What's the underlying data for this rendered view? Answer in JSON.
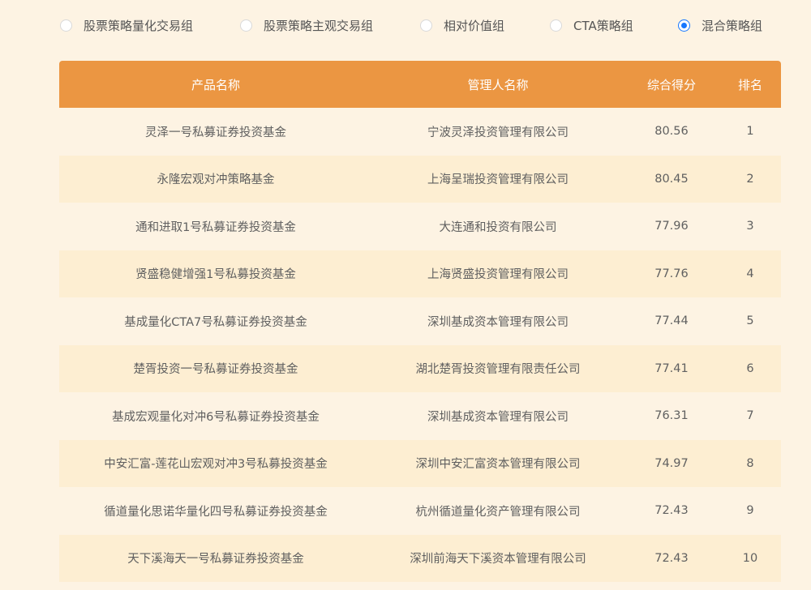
{
  "tabs": [
    {
      "label": "股票策略量化交易组",
      "checked": false
    },
    {
      "label": "股票策略主观交易组",
      "checked": false
    },
    {
      "label": "相对价值组",
      "checked": false
    },
    {
      "label": "CTA策略组",
      "checked": false
    },
    {
      "label": "混合策略组",
      "checked": true
    }
  ],
  "colors": {
    "header_bg": "#eb9642",
    "radio_accent": "#1677ff",
    "page_bg": "#fdf3e3",
    "row_alt_bg": "#fdeed2"
  },
  "table": {
    "headers": [
      "产品名称",
      "管理人名称",
      "综合得分",
      "排名"
    ],
    "rows": [
      [
        "灵泽一号私募证券投资基金",
        "宁波灵泽投资管理有限公司",
        "80.56",
        "1"
      ],
      [
        "永隆宏观对冲策略基金",
        "上海呈瑞投资管理有限公司",
        "80.45",
        "2"
      ],
      [
        "通和进取1号私募证券投资基金",
        "大连通和投资有限公司",
        "77.96",
        "3"
      ],
      [
        "贤盛稳健增强1号私募投资基金",
        "上海贤盛投资管理有限公司",
        "77.76",
        "4"
      ],
      [
        "基成量化CTA7号私募证券投资基金",
        "深圳基成资本管理有限公司",
        "77.44",
        "5"
      ],
      [
        "楚胥投资一号私募证券投资基金",
        "湖北楚胥投资管理有限责任公司",
        "77.41",
        "6"
      ],
      [
        "基成宏观量化对冲6号私募证券投资基金",
        "深圳基成资本管理有限公司",
        "76.31",
        "7"
      ],
      [
        "中安汇富-莲花山宏观对冲3号私募投资基金",
        "深圳中安汇富资本管理有限公司",
        "74.97",
        "8"
      ],
      [
        "循道量化思诺华量化四号私募证券投资基金",
        "杭州循道量化资产管理有限公司",
        "72.43",
        "9"
      ],
      [
        "天下溪海天一号私募证券投资基金",
        "深圳前海天下溪资本管理有限公司",
        "72.43",
        "10"
      ]
    ]
  }
}
